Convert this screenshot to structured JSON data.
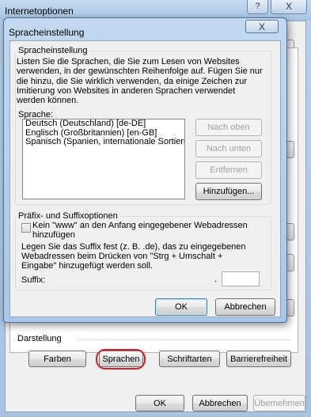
{
  "outer_window": {
    "title": "Internetoptionen",
    "help_label": "?",
    "close_label": "X",
    "darstellung": {
      "label": "Darstellung",
      "buttons": [
        "Farben",
        "Sprachen",
        "Schriftarten",
        "Barrierefreiheit"
      ],
      "highlighted": "Sprachen"
    },
    "footer": {
      "ok": "OK",
      "cancel": "Abbrechen",
      "apply": "Übernehmen"
    }
  },
  "dialog": {
    "title": "Spracheinstellung",
    "close_label": "X",
    "language_group": {
      "legend": "Spracheinstellung",
      "intro": "Listen Sie die Sprachen, die Sie zum Lesen von Websites verwenden, in der gewünschten Reihenfolge auf. Fügen Sie nur die hinzu, die Sie wirklich verwenden, da einige Zeichen zur Imitierung von Websites in anderen Sprachen verwendet werden können.",
      "list_label": "Sprache:",
      "languages": [
        "Deutsch (Deutschland) [de-DE]",
        "Englisch (Großbritannien) [en-GB]",
        "Spanisch (Spanien, internationale Sortierun"
      ],
      "buttons": {
        "up": "Nach oben",
        "down": "Nach unten",
        "remove": "Entfernen",
        "add": "Hinzufügen..."
      }
    },
    "suffix_group": {
      "legend": "Präfix- und Suffixoptionen",
      "checkbox_label": "Kein \"www\" an den Anfang eingegebener Webadressen hinzufügen",
      "checkbox_checked": false,
      "description": "Legen Sie das Suffix fest (z. B. .de), das zu eingegebenen Webadressen beim Drücken von \"Strg + Umschalt + Eingabe\" hinzugefügt werden soll.",
      "suffix_label": "Suffix:",
      "suffix_dot": ".",
      "suffix_value": ""
    },
    "footer": {
      "ok": "OK",
      "cancel": "Abbrechen"
    }
  }
}
